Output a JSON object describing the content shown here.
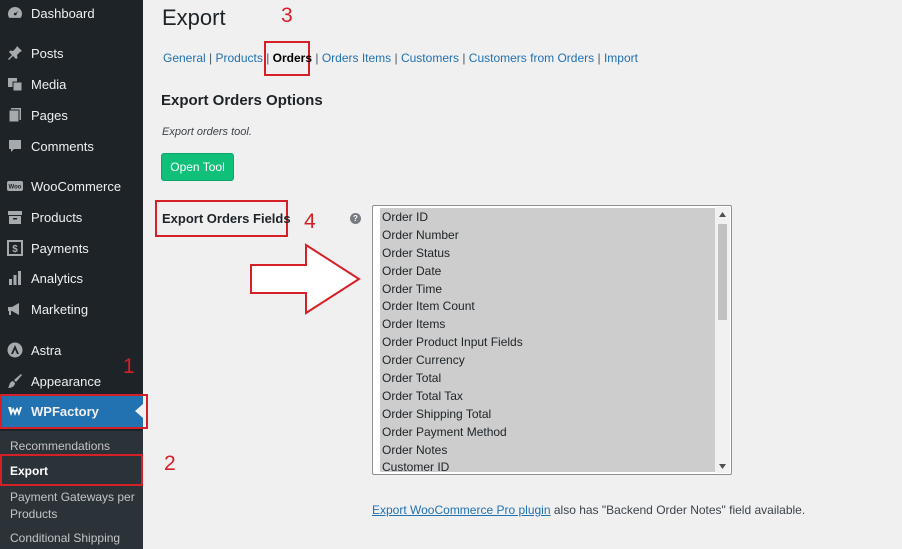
{
  "sidebar": {
    "items": [
      {
        "label": "Dashboard",
        "icon": "dashboard-icon"
      },
      {
        "label": "Posts",
        "icon": "pin-icon"
      },
      {
        "label": "Media",
        "icon": "media-icon"
      },
      {
        "label": "Pages",
        "icon": "pages-icon"
      },
      {
        "label": "Comments",
        "icon": "comment-icon"
      },
      {
        "label": "WooCommerce",
        "icon": "woo-icon"
      },
      {
        "label": "Products",
        "icon": "archive-icon"
      },
      {
        "label": "Payments",
        "icon": "dollar-icon"
      },
      {
        "label": "Analytics",
        "icon": "bar-chart-icon"
      },
      {
        "label": "Marketing",
        "icon": "megaphone-icon"
      },
      {
        "label": "Astra",
        "icon": "astra-icon"
      },
      {
        "label": "Appearance",
        "icon": "brush-icon"
      },
      {
        "label": "WPFactory",
        "icon": "wpfactory-icon"
      }
    ],
    "submenu": [
      {
        "label": "Recommendations"
      },
      {
        "label": "Export"
      },
      {
        "label": "Payment Gateways per Products"
      },
      {
        "label": "Conditional Shipping"
      }
    ]
  },
  "page": {
    "title": "Export",
    "tabs": [
      "General",
      "Products",
      "Orders",
      "Orders Items",
      "Customers",
      "Customers from Orders",
      "Import"
    ],
    "section_title": "Export Orders Options",
    "description": "Export orders tool.",
    "button_label": "Open Tool",
    "field_label": "Export Orders Fields",
    "help_glyph": "?",
    "fields": [
      "Order ID",
      "Order Number",
      "Order Status",
      "Order Date",
      "Order Time",
      "Order Item Count",
      "Order Items",
      "Order Product Input Fields",
      "Order Currency",
      "Order Total",
      "Order Total Tax",
      "Order Shipping Total",
      "Order Payment Method",
      "Order Notes",
      "Customer ID"
    ],
    "footnote_link": "Export WooCommerce Pro plugin",
    "footnote_text": " also has \"Backend Order Notes\" field available."
  },
  "annotations": {
    "numbers": [
      "1",
      "2",
      "3",
      "4"
    ],
    "color": "#d62027"
  },
  "colors": {
    "sidebar_bg": "#1d2327",
    "active_bg": "#2271b1",
    "link": "#2271b1",
    "button": "#0fbf7a"
  }
}
